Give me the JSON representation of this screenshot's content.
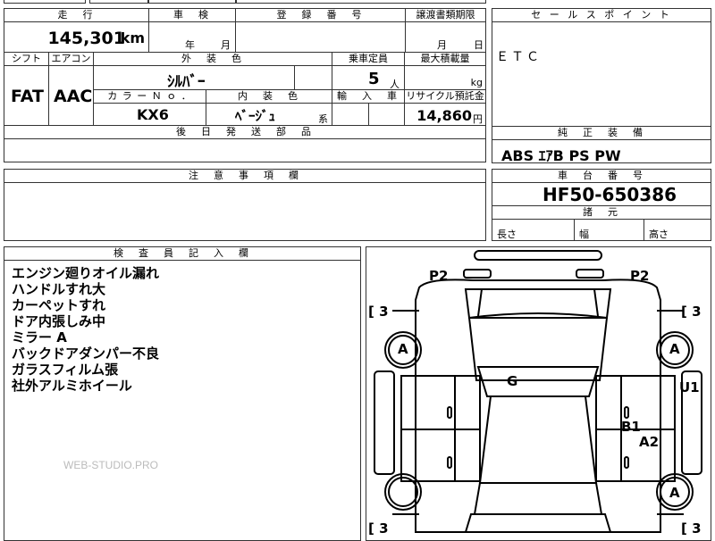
{
  "top_strip": {
    "partial_text": ""
  },
  "mileage": {
    "header": "走　行",
    "value": "145,301",
    "unit": "km"
  },
  "inspection": {
    "header": "車　検",
    "year_label": "年",
    "month_label": "月"
  },
  "registration": {
    "header": "登　録　番　号",
    "value": ""
  },
  "transfer_deadline": {
    "header": "譲渡書類期限",
    "month_label": "月",
    "day_label": "日"
  },
  "shift": {
    "header": "シフト",
    "value": "FAT"
  },
  "aircon": {
    "header": "エアコン",
    "value": "AAC"
  },
  "exterior_color": {
    "header": "外　装　色",
    "value": "ｼﾙﾊﾞｰ"
  },
  "capacity": {
    "header": "乗車定員",
    "value": "5",
    "unit": "人"
  },
  "max_load": {
    "header": "最大積載量",
    "unit": "kg"
  },
  "color_no": {
    "header": "カ ラ ー Ｎ ｏ ．",
    "value": "KX6"
  },
  "interior_color": {
    "header": "内　装　色",
    "value": "ﾍﾞｰｼﾞｭ",
    "suffix": "系"
  },
  "import": {
    "header": "輸　入　車"
  },
  "recycle": {
    "header": "リサイクル預託金",
    "value": "14,860",
    "unit": "円"
  },
  "followup_parts": {
    "header": "後　日　発　送　部　品"
  },
  "sales_points": {
    "header": "セ ー ル ス ポ イ ン ト",
    "items": [
      "ＥＴＣ"
    ]
  },
  "standard_equipment": {
    "header": "純　正　装　備",
    "value": "ABS ｴｱB PS PW"
  },
  "caution": {
    "header": "注　意　事　項　欄"
  },
  "chassis": {
    "header": "車　台　番　号",
    "value": "HF50-650386"
  },
  "specs": {
    "header": "諸　元",
    "length_label": "長さ",
    "width_label": "幅",
    "height_label": "高さ"
  },
  "inspector_notes": {
    "header": "検　査　員　記　入　欄",
    "lines": [
      "エンジン廻りオイル漏れ",
      "ハンドルすれ大",
      "カーペットすれ",
      "ドア内張しみ中",
      "ミラー A",
      "バックドアダンパー不良",
      "ガラスフィルム張",
      "社外アルミホイール"
    ],
    "watermark": "WEB-STUDIO.PRO"
  },
  "diagram": {
    "labels": {
      "p2_left": "P2",
      "p2_right": "P2",
      "bracket_tl": "[ 3",
      "bracket_tr": "[ 3",
      "bracket_bl": "[ 3",
      "bracket_br": "[ 3",
      "wheel_fl": "A",
      "wheel_fr": "A",
      "wheel_rr": "A",
      "roof": "G",
      "u1": "U1",
      "b1": "B1",
      "a2": "A2"
    }
  }
}
